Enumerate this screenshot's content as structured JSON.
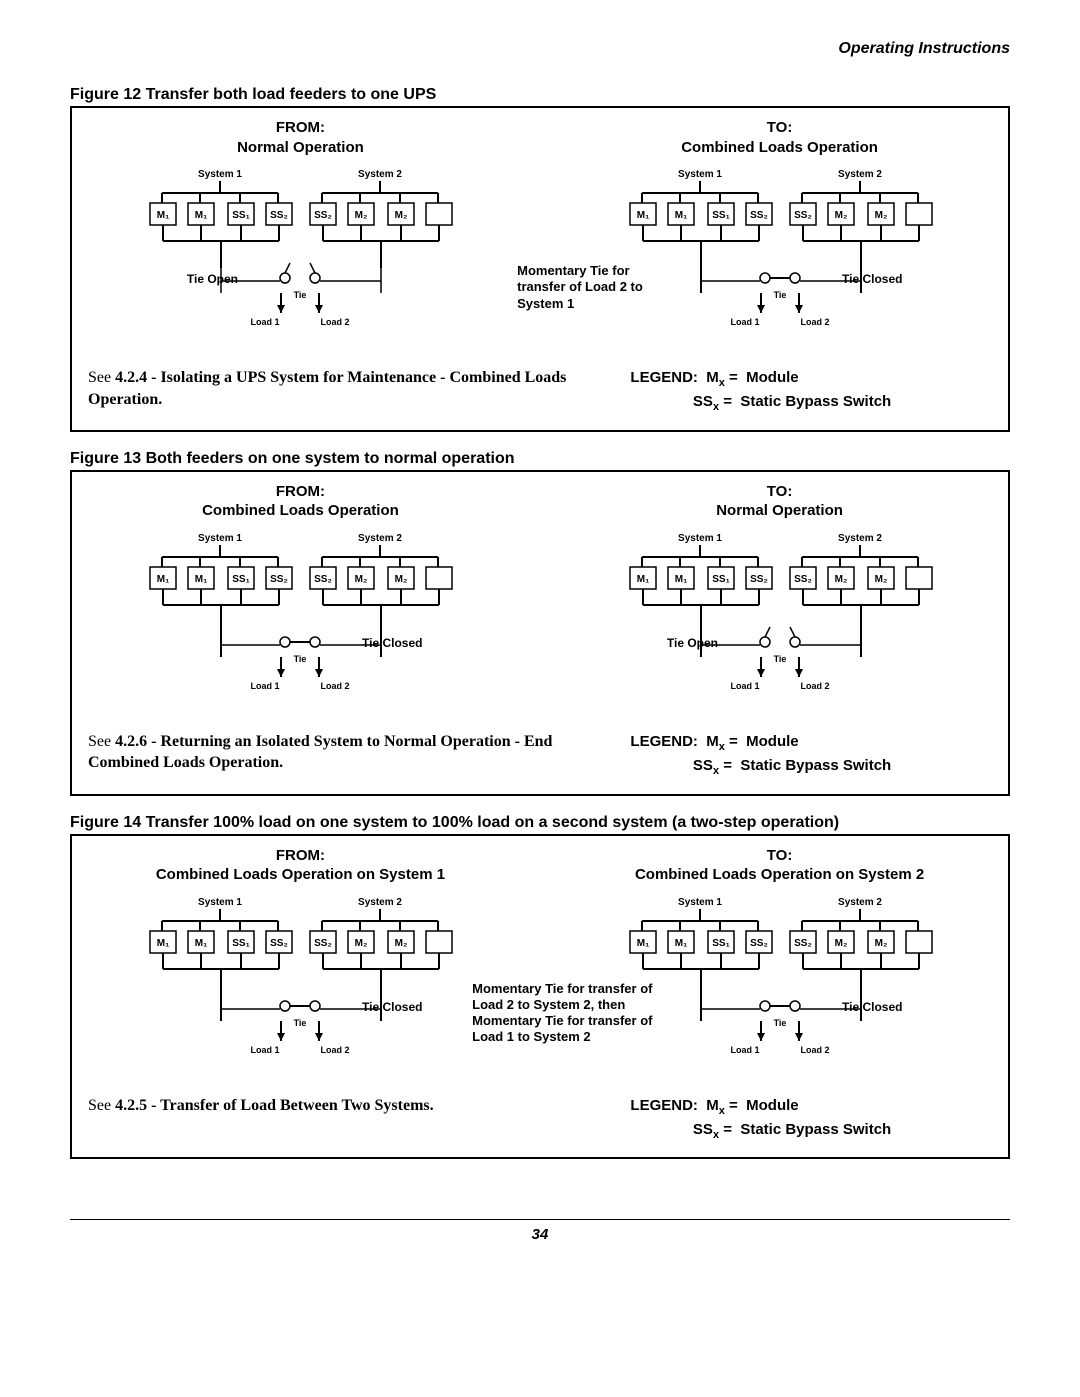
{
  "page_header": "Operating Instructions",
  "page_number": "34",
  "legend": {
    "label": "LEGEND:",
    "m_symbol": "M",
    "m_sub": "x",
    "m_eq": " =  Module",
    "ss_symbol": "SS",
    "ss_sub": "x",
    "ss_eq": " =  Static Bypass Switch"
  },
  "diagram_labels": {
    "system1": "System 1",
    "system2": "System 2",
    "boxes": [
      "M₁",
      "M₁",
      "SS₁",
      "SS₂",
      "M₂",
      "M₂"
    ],
    "tie": "Tie",
    "load1": "Load 1",
    "load2": "Load 2",
    "tie_open": "Tie Open",
    "tie_closed": "Tie Closed"
  },
  "figures": [
    {
      "caption": "Figure 12  Transfer both load feeders to one UPS",
      "from_title_line1": "FROM:",
      "from_title_line2": "Normal Operation",
      "to_title_line1": "TO:",
      "to_title_line2": "Combined Loads Operation",
      "from_tie_label": "Tie Open",
      "to_tie_label": "Tie Closed",
      "to_momentary_note": "Momentary Tie for transfer of Load 2 to System 1",
      "see_text": "See 4.2.4 - Isolating a UPS System for Maintenance - Combined Loads Operation."
    },
    {
      "caption": "Figure 13  Both feeders on one system to normal operation",
      "from_title_line1": "FROM:",
      "from_title_line2": "Combined Loads Operation",
      "to_title_line1": "TO:",
      "to_title_line2": "Normal Operation",
      "from_tie_label": "Tie Closed",
      "to_tie_label": "Tie Open",
      "to_momentary_note": "",
      "see_text": "See 4.2.6 - Returning an Isolated System to Normal Operation - End Combined Loads Operation."
    },
    {
      "caption": "Figure 14  Transfer 100% load on one system to 100% load on a second system (a two-step operation)",
      "from_title_line1": "FROM:",
      "from_title_line2": "Combined Loads Operation on System 1",
      "to_title_line1": "TO:",
      "to_title_line2": "Combined Loads Operation on System 2",
      "from_tie_label": "Tie Closed",
      "to_tie_label": "Tie Closed",
      "to_momentary_note": "Momentary Tie for transfer of Load 2 to System 2, then Momentary Tie for transfer of Load 1 to System 2",
      "see_text": "See 4.2.5 - Transfer of Load Between Two Systems."
    }
  ]
}
